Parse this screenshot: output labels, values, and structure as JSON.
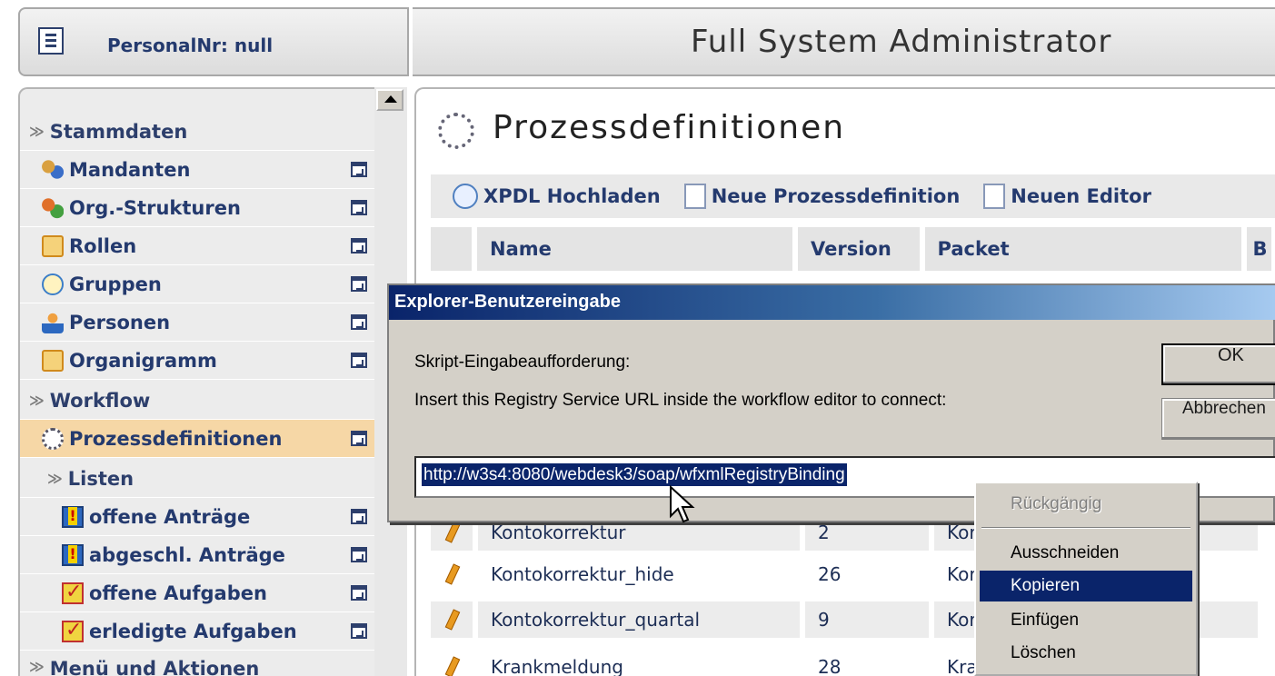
{
  "header": {
    "personal_nr": "PersonalNr: null",
    "role_title": "Full System Administrator"
  },
  "sidebar": {
    "sections": [
      {
        "label": "Stammdaten"
      },
      {
        "label": "Workflow"
      },
      {
        "label": "Listen"
      },
      {
        "label": "Menü und Aktionen"
      }
    ],
    "items": [
      {
        "label": "Mandanten",
        "icon": "people-icon"
      },
      {
        "label": "Org.-Strukturen",
        "icon": "org-structure-icon"
      },
      {
        "label": "Rollen",
        "icon": "roles-icon"
      },
      {
        "label": "Gruppen",
        "icon": "groups-icon"
      },
      {
        "label": "Personen",
        "icon": "person-icon"
      },
      {
        "label": "Organigramm",
        "icon": "organigram-icon"
      },
      {
        "label": "Prozessdefinitionen",
        "icon": "gear-icon",
        "active": true
      },
      {
        "label": "offene Anträge",
        "icon": "exclamation-icon"
      },
      {
        "label": "abgeschl. Anträge",
        "icon": "exclamation-icon"
      },
      {
        "label": "offene Aufgaben",
        "icon": "checkbox-icon"
      },
      {
        "label": "erledigte Aufgaben",
        "icon": "checkbox-icon"
      }
    ]
  },
  "main": {
    "page_title": "Prozessdefinitionen",
    "toolbar": {
      "upload_xpdl": "XPDL Hochladen",
      "new_definition": "Neue Prozessdefinition",
      "new_editor": "Neuen Editor"
    },
    "table": {
      "columns": [
        "Name",
        "Version",
        "Packet",
        "B"
      ],
      "rows": [
        {
          "name": "Kontokorrektur",
          "version": "2",
          "packet": "Kor"
        },
        {
          "name": "Kontokorrektur_hide",
          "version": "26",
          "packet": "Kor"
        },
        {
          "name": "Kontokorrektur_quartal",
          "version": "9",
          "packet": "Kor"
        },
        {
          "name": "Krankmeldung",
          "version": "28",
          "packet": "Kra"
        }
      ]
    }
  },
  "dialog": {
    "title": "Explorer-Benutzereingabe",
    "prompt_label": "Skript-Eingabeaufforderung:",
    "message": "Insert this Registry Service URL inside the workflow editor to connect:",
    "ok_label": "OK",
    "cancel_label": "Abbrechen",
    "input_value": "http://w3s4:8080/webdesk3/soap/wfxmlRegistryBinding"
  },
  "context_menu": {
    "items": [
      {
        "label": "Rückgängig",
        "disabled": true
      },
      {
        "label": "Ausschneiden"
      },
      {
        "label": "Kopieren",
        "selected": true
      },
      {
        "label": "Einfügen"
      },
      {
        "label": "Löschen"
      }
    ]
  },
  "colors": {
    "nav_text": "#243a6e",
    "active_item": "#f6d7a6",
    "dialog_titlebar": "#0a246a",
    "menu_highlight": "#0a246a"
  }
}
